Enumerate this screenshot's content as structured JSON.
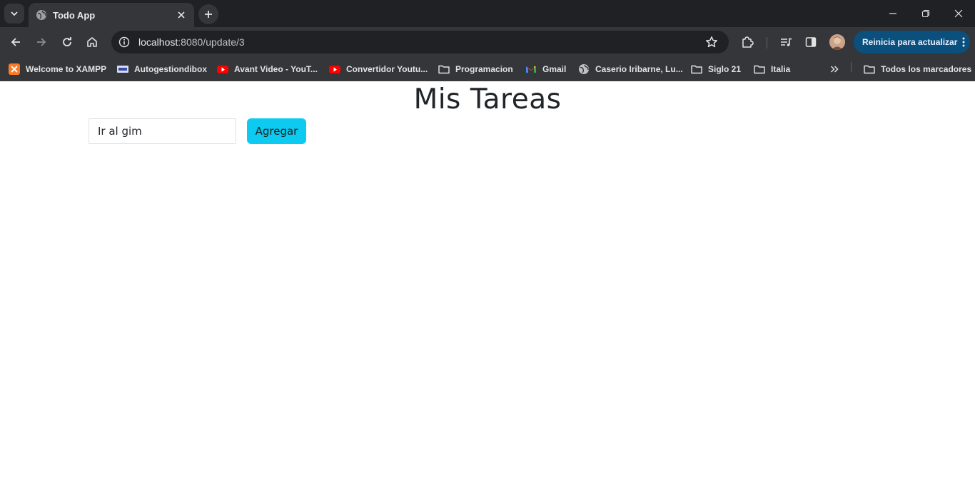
{
  "browser": {
    "tab": {
      "title": "Todo App"
    },
    "omnibox": {
      "host": "localhost",
      "path": ":8080/update/3"
    },
    "update_button": {
      "label": "Reinicia para actualizar"
    },
    "bookmarks": [
      {
        "label": "Welcome to XAMPP",
        "icon": "xampp-icon"
      },
      {
        "label": "Autogestiondibox",
        "icon": "dibox-icon"
      },
      {
        "label": "Avant Video - YouT...",
        "icon": "youtube-icon"
      },
      {
        "label": "Convertidor Youtu...",
        "icon": "youtube-icon"
      },
      {
        "label": "Programacion",
        "icon": "folder-icon"
      },
      {
        "label": "Gmail",
        "icon": "gmail-icon"
      },
      {
        "label": "Caserio Iribarne, Lu...",
        "icon": "globe-icon"
      },
      {
        "label": "Siglo 21",
        "icon": "folder-icon"
      },
      {
        "label": "Italia",
        "icon": "folder-icon"
      }
    ],
    "all_bookmarks": {
      "label": "Todos los marcadores",
      "icon": "folder-icon"
    },
    "colors": {
      "frame": "#202124",
      "toolbar": "#35363a",
      "update_button": "#0b4f7c"
    }
  },
  "app": {
    "title": "Mis Tareas",
    "input": {
      "value": "Ir al gim",
      "placeholder": ""
    },
    "add_button": {
      "label": "Agregar"
    },
    "colors": {
      "add_button": "#0dcaf0",
      "title": "#212529"
    }
  }
}
